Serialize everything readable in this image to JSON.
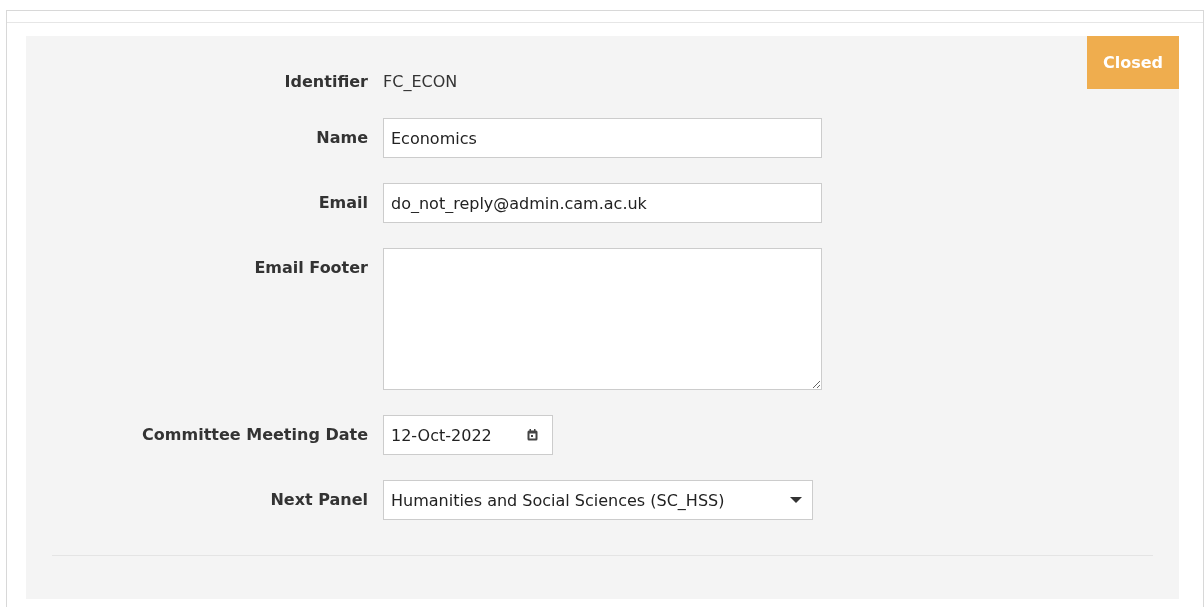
{
  "status_badge": "Closed",
  "fields": [
    {
      "kind": "text",
      "label": "Identifier",
      "value": "FC_ECON"
    },
    {
      "kind": "input",
      "label": "Name",
      "value": "Economics"
    },
    {
      "kind": "input",
      "label": "Email",
      "value": "do_not_reply@admin.cam.ac.uk"
    },
    {
      "kind": "textarea",
      "label": "Email Footer"
    },
    {
      "kind": "date",
      "label": "Committee Meeting Date",
      "value": "12-Oct-2022"
    },
    {
      "kind": "select",
      "label": "Next Panel",
      "value": "Humanities and Social Sciences (SC_HSS)"
    }
  ]
}
